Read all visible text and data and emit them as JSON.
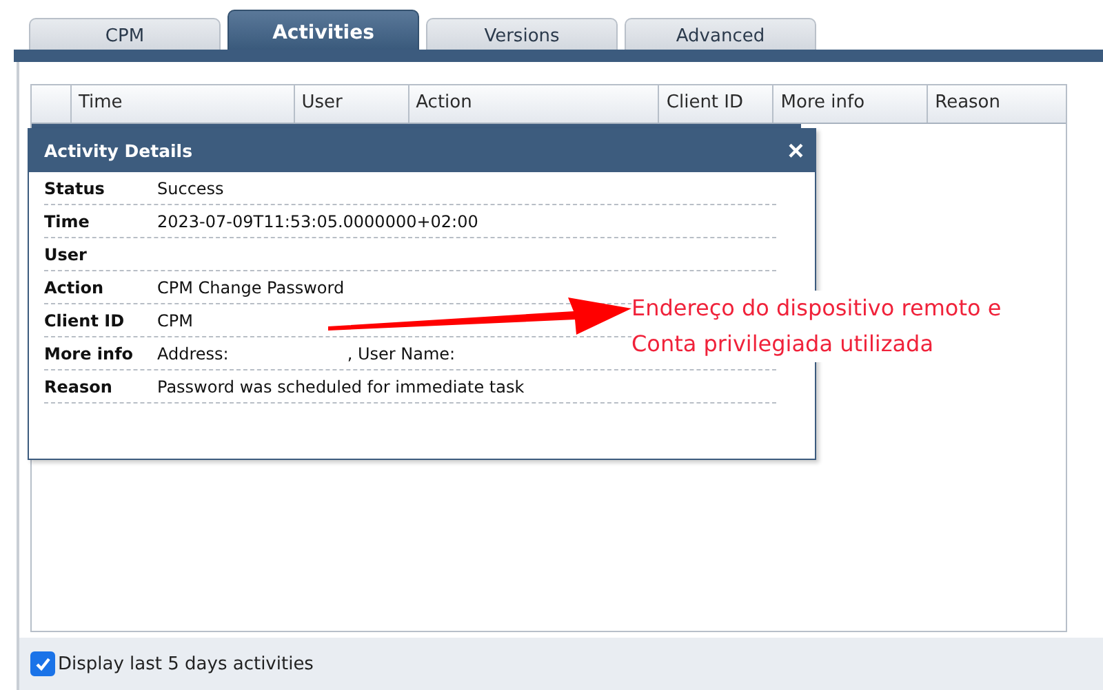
{
  "tabs": [
    {
      "label": "CPM",
      "selected": false
    },
    {
      "label": "Activities",
      "selected": true
    },
    {
      "label": "Versions",
      "selected": false
    },
    {
      "label": "Advanced",
      "selected": false
    }
  ],
  "table": {
    "columns": [
      "Time",
      "User",
      "Action",
      "Client ID",
      "More info",
      "Reason"
    ]
  },
  "dialog": {
    "title": "Activity Details",
    "close": "×",
    "rows": [
      {
        "label": "Status",
        "values": [
          "Success"
        ]
      },
      {
        "label": "Time",
        "values": [
          "2023-07-09T11:53:05.0000000+02:00"
        ]
      },
      {
        "label": "User",
        "values": []
      },
      {
        "label": "Action",
        "values": [
          "CPM Change Password"
        ]
      },
      {
        "label": "Client ID",
        "values": [
          "CPM"
        ]
      },
      {
        "label": "More info",
        "values": [
          "Address:",
          ", User Name:"
        ]
      },
      {
        "label": "Reason",
        "values": [
          "Password was scheduled for immediate task"
        ]
      }
    ]
  },
  "annotation": {
    "lines": [
      "Endereço do dispositivo remoto e",
      "Conta privilegiada utilizada"
    ]
  },
  "footer": {
    "checkbox": {
      "label": "Display last 5 days activities",
      "checked": true
    }
  }
}
